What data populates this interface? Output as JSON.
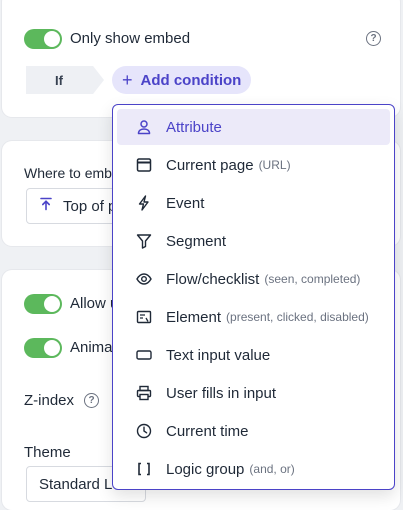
{
  "embed_card": {
    "toggle_label": "Only show embed",
    "help": "?",
    "if_label": "If",
    "add_condition_label": "Add condition"
  },
  "placement_card": {
    "label": "Where to emb",
    "field_value": "Top of p"
  },
  "options_card": {
    "allow_label": "Allow u",
    "animate_label": "Anima",
    "zindex_label": "Z-index",
    "help": "?",
    "theme_label": "Theme",
    "theme_value": "Standard L"
  },
  "condition_menu": {
    "items": [
      {
        "label": "Attribute",
        "sub": "",
        "icon": "person-icon"
      },
      {
        "label": "Current page",
        "sub": "(URL)",
        "icon": "browser-window-icon"
      },
      {
        "label": "Event",
        "sub": "",
        "icon": "lightning-icon"
      },
      {
        "label": "Segment",
        "sub": "",
        "icon": "filter-icon"
      },
      {
        "label": "Flow/checklist",
        "sub": "(seen, completed)",
        "icon": "eye-icon"
      },
      {
        "label": "Element",
        "sub": "(present, clicked, disabled)",
        "icon": "element-icon"
      },
      {
        "label": "Text input value",
        "sub": "",
        "icon": "text-input-icon"
      },
      {
        "label": "User fills in input",
        "sub": "",
        "icon": "printer-icon"
      },
      {
        "label": "Current time",
        "sub": "",
        "icon": "clock-icon"
      },
      {
        "label": "Logic group",
        "sub": "(and, or)",
        "icon": "brackets-icon"
      }
    ]
  },
  "colors": {
    "accent": "#4b43c8",
    "toggle_on": "#5cb85c",
    "active_item_bg": "#eceaf9"
  }
}
